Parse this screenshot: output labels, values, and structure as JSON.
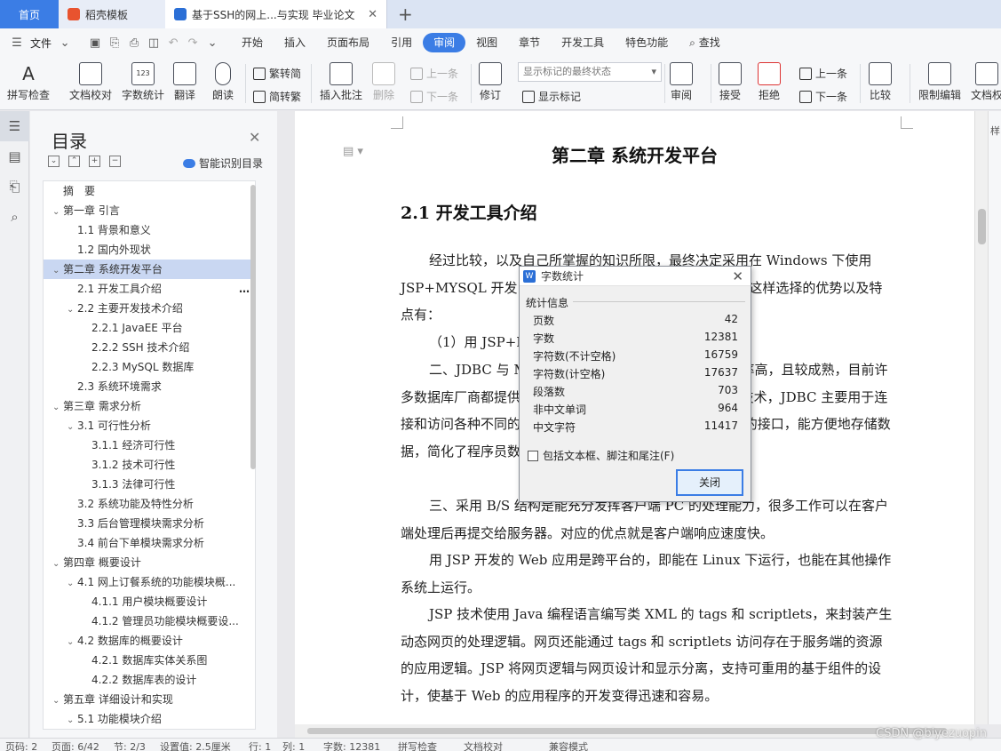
{
  "tabs": {
    "home": "首页",
    "template": "稻壳模板",
    "document": "基于SSH的网上...与实现 毕业论文",
    "template_color": "#e8532f",
    "doc_color": "#2b6fd6"
  },
  "menubar": {
    "file": "文件",
    "tabs": [
      "开始",
      "插入",
      "页面布局",
      "引用",
      "审阅",
      "视图",
      "章节",
      "开发工具",
      "特色功能"
    ],
    "active_tab": "审阅",
    "search": "查找",
    "accent": "#3b7de5"
  },
  "ribbon": {
    "spell_check": "拼写检查",
    "doc_proof": "文档校对",
    "word_count": "字数统计",
    "translate": "翻译",
    "read_aloud": "朗读",
    "trad_to_simp": "繁转简",
    "simp_to_trad": "简转繁",
    "insert_comment": "插入批注",
    "delete": "删除",
    "prev_item": "上一条",
    "next_item": "下一条",
    "revise": "修订",
    "markup_state": "显示标记的最终状态",
    "show_markup": "显示标记",
    "review": "审阅",
    "accept": "接受",
    "reject": "拒绝",
    "prev": "上一条",
    "next": "下一条",
    "compare": "比较",
    "restrict_edit": "限制编辑",
    "doc_rights": "文档权"
  },
  "toc": {
    "title": "目录",
    "smart_toc": "智能识别目录",
    "items": [
      {
        "text": "摘　要",
        "level": 0,
        "arrow": ""
      },
      {
        "text": "第一章 引言",
        "level": 0,
        "arrow": "⌄"
      },
      {
        "text": "1.1 背景和意义",
        "level": 1,
        "arrow": ""
      },
      {
        "text": "1.2 国内外现状",
        "level": 1,
        "arrow": ""
      },
      {
        "text": "第二章 系统开发平台",
        "level": 0,
        "arrow": "⌄",
        "selected": true
      },
      {
        "text": "2.1 开发工具介绍",
        "level": 1,
        "arrow": "",
        "more": true
      },
      {
        "text": "2.2 主要开发技术介绍",
        "level": 1,
        "arrow": "⌄"
      },
      {
        "text": "2.2.1 JavaEE 平台",
        "level": 2,
        "arrow": ""
      },
      {
        "text": "2.2.2 SSH 技术介绍",
        "level": 2,
        "arrow": ""
      },
      {
        "text": "2.2.3 MySQL 数据库",
        "level": 2,
        "arrow": ""
      },
      {
        "text": "2.3 系统环境需求",
        "level": 1,
        "arrow": ""
      },
      {
        "text": "第三章 需求分析",
        "level": 0,
        "arrow": "⌄"
      },
      {
        "text": "3.1 可行性分析",
        "level": 1,
        "arrow": "⌄"
      },
      {
        "text": "3.1.1 经济可行性",
        "level": 2,
        "arrow": ""
      },
      {
        "text": "3.1.2 技术可行性",
        "level": 2,
        "arrow": ""
      },
      {
        "text": "3.1.3 法律可行性",
        "level": 2,
        "arrow": ""
      },
      {
        "text": "3.2 系统功能及特性分析",
        "level": 1,
        "arrow": ""
      },
      {
        "text": "3.3 后台管理模块需求分析",
        "level": 1,
        "arrow": ""
      },
      {
        "text": "3.4 前台下单模块需求分析",
        "level": 1,
        "arrow": ""
      },
      {
        "text": "第四章 概要设计",
        "level": 0,
        "arrow": "⌄"
      },
      {
        "text": "4.1 网上订餐系统的功能模块概...",
        "level": 1,
        "arrow": "⌄"
      },
      {
        "text": "4.1.1 用户模块概要设计",
        "level": 2,
        "arrow": ""
      },
      {
        "text": "4.1.2 管理员功能模块概要设...",
        "level": 2,
        "arrow": ""
      },
      {
        "text": "4.2 数据库的概要设计",
        "level": 1,
        "arrow": "⌄"
      },
      {
        "text": "4.2.1 数据库实体关系图",
        "level": 2,
        "arrow": ""
      },
      {
        "text": "4.2.2 数据库表的设计",
        "level": 2,
        "arrow": ""
      },
      {
        "text": "第五章 详细设计和实现",
        "level": 0,
        "arrow": "⌄"
      },
      {
        "text": "5.1 功能模块介绍",
        "level": 1,
        "arrow": "⌄"
      }
    ]
  },
  "document": {
    "chapter": "第二章  系统开发平台",
    "section": "2.1 开发工具介绍",
    "paragraphs": [
      {
        "text": "经过比较，以及自己所掌握的知识所限，最终决定采用在 Windows 下使用 JSP+MYSQL 开发，数据库服务器选用 MySQL 数据库。这样选择的优势以及特点有：",
        "indent": true
      },
      {
        "text": "（1）用 JSP+MYSQL 开发，技术成熟，稳定性较好。",
        "indent": true
      },
      {
        "text": "二、JDBC 与 MySQL 数据库连接方便，同时存取效率高，且较成熟，目前许多数据库厂商都提供了支持，是 Microsoft 主要数据存储技术，JDBC 主要用于连接和访问各种不同的数据源。JDBC 封装了 OLE-DB 复杂的接口，能方便地存储数据，简化了程序员数据存取的工作。",
        "indent": true
      },
      {
        "text": "三、采用 B/S 结构是能充分发挥客户端 PC 的处理能力，很多工作可以在客户端处理后再提交给服务器。对应的优点就是客户端响应速度快。",
        "indent": true
      },
      {
        "text": "用 JSP 开发的 Web 应用是跨平台的，即能在 Linux 下运行，也能在其他操作系统上运行。",
        "indent": true
      },
      {
        "text": "JSP 技术使用 Java 编程语言编写类 XML 的 tags 和 scriptlets，来封装产生动态网页的处理逻辑。网页还能通过 tags 和 scriptlets 访问存在于服务端的资源的应用逻辑。JSP 将网页逻辑与网页设计和显示分离，支持可重用的基于组件的设计，使基于 Web 的应用程序的开发变得迅速和容易。",
        "indent": true
      }
    ]
  },
  "dialog": {
    "title": "字数统计",
    "group": "统计信息",
    "stats": [
      {
        "label": "页数",
        "value": "42"
      },
      {
        "label": "字数",
        "value": "12381"
      },
      {
        "label": "字符数(不计空格)",
        "value": "16759"
      },
      {
        "label": "字符数(计空格)",
        "value": "17637"
      },
      {
        "label": "段落数",
        "value": "703"
      },
      {
        "label": "非中文单词",
        "value": "964"
      },
      {
        "label": "中文字符",
        "value": "11417"
      }
    ],
    "checkbox": "包括文本框、脚注和尾注(F)",
    "close_button": "关闭"
  },
  "status": {
    "page_no": "页码: 2",
    "page": "页面: 6/42",
    "section": "节: 2/3",
    "setting": "设置值: 2.5厘米",
    "row": "行: 1",
    "col": "列: 1",
    "words": "字数: 12381",
    "spell": "拼写检查",
    "proof": "文档校对",
    "compat": "兼容模式"
  },
  "watermark": "CSDN @biyezuopin",
  "right_panel_label": "样"
}
